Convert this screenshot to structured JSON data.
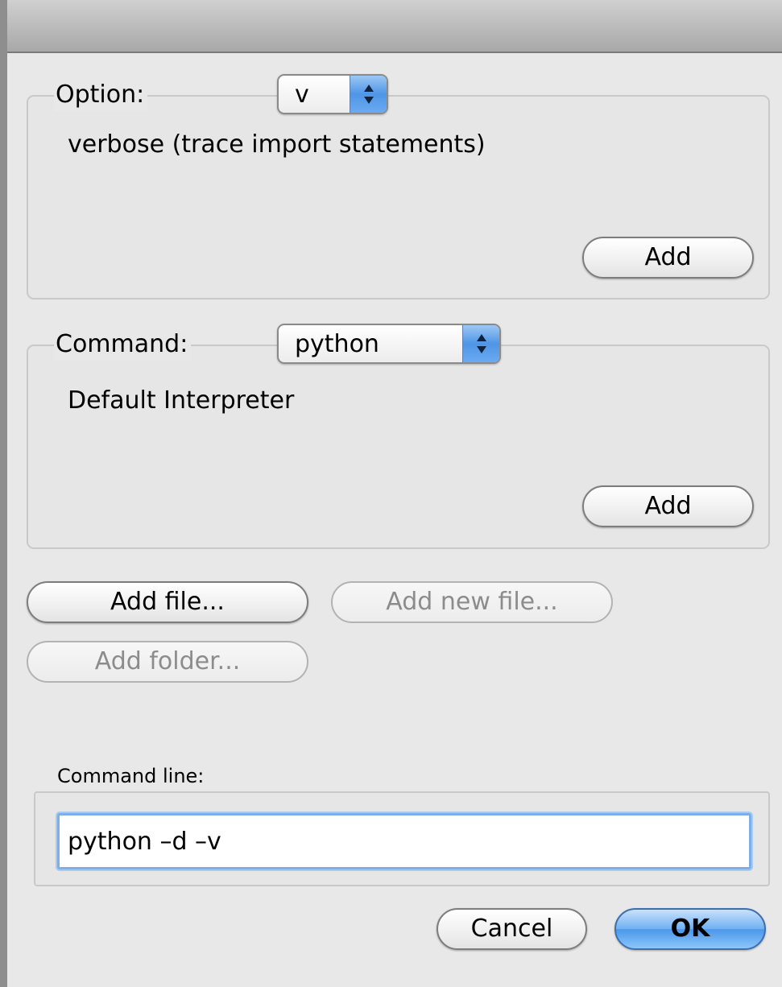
{
  "option_group": {
    "label": "Option:",
    "selected": "v",
    "description": "verbose (trace import statements)",
    "add_label": "Add"
  },
  "command_group": {
    "label": "Command:",
    "selected": "python",
    "description": "Default Interpreter",
    "add_label": "Add"
  },
  "file_buttons": {
    "add_file": "Add file...",
    "add_new_file": "Add new file...",
    "add_folder": "Add folder..."
  },
  "command_line": {
    "label": "Command line:",
    "value": "python –d –v"
  },
  "footer": {
    "cancel": "Cancel",
    "ok": "OK"
  },
  "colors": {
    "accent_blue": "#4b97ea",
    "window_bg": "#e8e8e8"
  },
  "icons": {
    "popup_arrows": "up-down-chevron-icon"
  }
}
